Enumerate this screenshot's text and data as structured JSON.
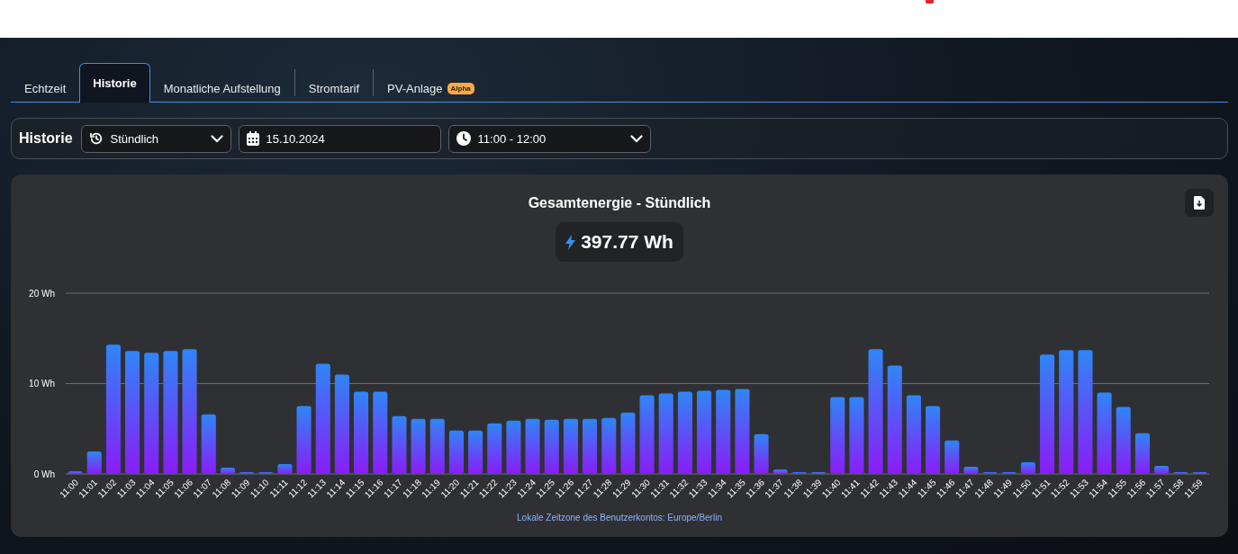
{
  "tabs": [
    {
      "label": "Echtzeit",
      "selected": false
    },
    {
      "label": "Historie",
      "selected": true
    },
    {
      "label": "Monatliche Aufstellung",
      "selected": false
    },
    {
      "label": "Stromtarif",
      "selected": false
    },
    {
      "label": "PV-Anlage",
      "selected": false,
      "badge": "Alpha"
    }
  ],
  "filter_bar": {
    "label": "Historie",
    "interval": "Stündlich",
    "date": "15.10.2024",
    "time_range": "11:00 - 12:00"
  },
  "energy_card": {
    "title": "Gesamtenergie - Stündlich",
    "total": "397.77 Wh",
    "chart_data": {
      "type": "bar",
      "categories": [
        "11:00",
        "11:01",
        "11:02",
        "11:03",
        "11:04",
        "11:05",
        "11:06",
        "11:07",
        "11:08",
        "11:09",
        "11:10",
        "11:11",
        "11:12",
        "11:13",
        "11:14",
        "11:15",
        "11:16",
        "11:17",
        "11:18",
        "11:19",
        "11:20",
        "11:21",
        "11:22",
        "11:23",
        "11:24",
        "11:25",
        "11:26",
        "11:27",
        "11:28",
        "11:29",
        "11:30",
        "11:31",
        "11:32",
        "11:33",
        "11:34",
        "11:35",
        "11:36",
        "11:37",
        "11:38",
        "11:39",
        "11:40",
        "11:41",
        "11:42",
        "11:43",
        "11:44",
        "11:45",
        "11:46",
        "11:47",
        "11:48",
        "11:49",
        "11:50",
        "11:51",
        "11:52",
        "11:53",
        "11:54",
        "11:55",
        "11:56",
        "11:57",
        "11:58",
        "11:59"
      ],
      "values": [
        0.3,
        2.5,
        14.3,
        13.6,
        13.4,
        13.6,
        13.8,
        6.6,
        0.7,
        0.2,
        0.2,
        1.1,
        7.5,
        12.2,
        11.0,
        9.1,
        9.1,
        6.4,
        6.1,
        6.1,
        4.8,
        4.8,
        5.6,
        5.9,
        6.1,
        6.0,
        6.1,
        6.1,
        6.2,
        6.8,
        8.7,
        8.9,
        9.1,
        9.2,
        9.3,
        9.4,
        4.4,
        0.5,
        0.2,
        0.2,
        8.5,
        8.5,
        13.8,
        12.0,
        8.7,
        7.5,
        3.7,
        0.8,
        0.2,
        0.2,
        1.3,
        13.2,
        13.7,
        13.7,
        9.0,
        7.4,
        4.5,
        0.9,
        0.2,
        0.2
      ],
      "ylim": [
        0,
        20
      ],
      "yticks": [
        {
          "value": 0,
          "label": "0 Wh"
        },
        {
          "value": 10,
          "label": "10 Wh"
        },
        {
          "value": 20,
          "label": "20 Wh"
        }
      ]
    },
    "footnote": "Lokale Zeitzone des Benutzerkontos: Europe/Berlin"
  }
}
